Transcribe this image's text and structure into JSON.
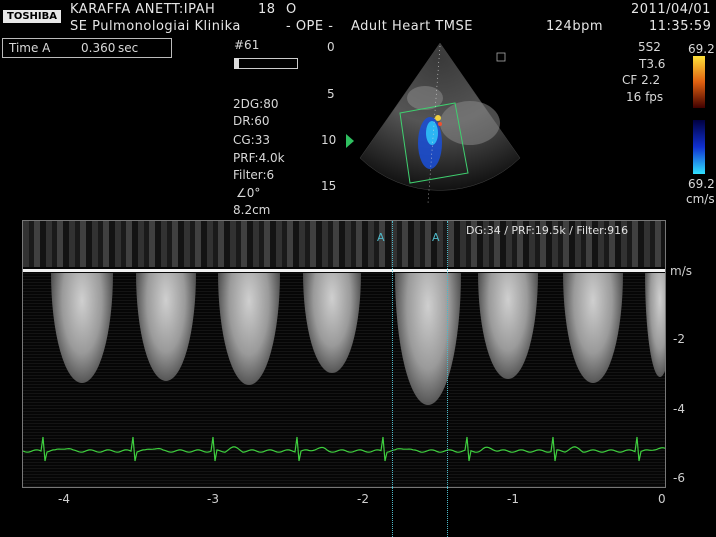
{
  "header": {
    "brand": "TOSHIBA",
    "patient": "KARAFFA ANETT:IPAH",
    "patient_num": "18",
    "patient_code": "O",
    "date": "2011/04/01",
    "clinic": "SE Pulmonologiai Klinika",
    "dept": "- OPE -",
    "preset": "Adult Heart TMSE",
    "bpm": "124bpm",
    "time": "11:35:59"
  },
  "measurement": {
    "label": "Time A",
    "value": "0.360",
    "unit": "sec"
  },
  "gate": {
    "frame_label": "#61"
  },
  "params": {
    "dg": "2DG:80",
    "dr": "DR:60",
    "cg": "CG:33",
    "prf": "PRF:4.0k",
    "filter": "Filter:6",
    "angle": "∠0°",
    "depth": "8.2cm"
  },
  "depth_scale": [
    "0",
    "5",
    "10",
    "15"
  ],
  "probe": {
    "model": "5S2",
    "t": "T3.6",
    "cf": "CF 2.2",
    "fps": "16 fps"
  },
  "color_scale": {
    "top": "69.2",
    "bottom": "69.2",
    "unit": "cm/s",
    "top_color": "#f6d000",
    "bottom_color": "#1ab6ff"
  },
  "doppler": {
    "header": "DG:34 /   PRF:19.5k / Filter:916",
    "marker_a1": "A",
    "marker_a2": "A",
    "unit": "m/s",
    "y_labels": [
      "-2",
      "-4",
      "-6"
    ],
    "x_labels": [
      "-4",
      "-3",
      "-2",
      "-1",
      "0"
    ],
    "ecg_color": "#3fcf3f"
  }
}
